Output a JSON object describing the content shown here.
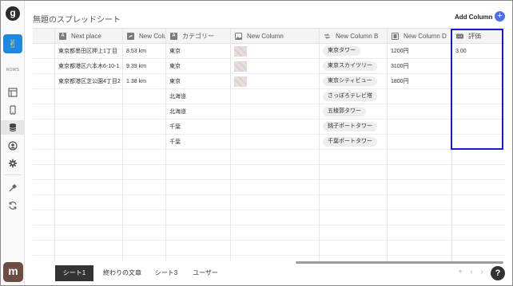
{
  "app": {
    "logo_letter": "g",
    "app_emoji": "✌",
    "rows_label": "ROWS",
    "avatar_letter": "m"
  },
  "header": {
    "title": "無題のスプレッドシート",
    "add_column_label": "Add Column",
    "add_symbol": "+"
  },
  "columns": [
    {
      "label": "Next place",
      "icon": "text-type-icon"
    },
    {
      "label": "New Column",
      "icon": "link-icon"
    },
    {
      "label": "カテゴリー",
      "icon": "text-type-icon"
    },
    {
      "label": "New Column",
      "icon": "image-icon"
    },
    {
      "label": "New Column B",
      "icon": "relation-icon"
    },
    {
      "label": "New Column D",
      "icon": "number-icon"
    },
    {
      "label": "評価",
      "icon": "rating-icon"
    }
  ],
  "rows": [
    {
      "address": "東京都墨田区押上1丁目",
      "distance": "8.53 km",
      "category": "東京",
      "place": "東京タワー",
      "price": "1200円",
      "rating": "3.00"
    },
    {
      "address": "東京都港区六本木6-10-1",
      "distance": "9.39 km",
      "category": "東京",
      "place": "東京スカイツリー",
      "price": "3100円",
      "rating": ""
    },
    {
      "address": "東京都港区芝公園4丁目2",
      "distance": "1.38 km",
      "category": "東京",
      "place": "東京シティビュー",
      "price": "1800円",
      "rating": ""
    },
    {
      "address": "",
      "distance": "",
      "category": "北海道",
      "place": "さっぽろテレビ塔",
      "price": "",
      "rating": ""
    },
    {
      "address": "",
      "distance": "",
      "category": "北海道",
      "place": "五稜郭タワー",
      "price": "",
      "rating": ""
    },
    {
      "address": "",
      "distance": "",
      "category": "千葉",
      "place": "銚子ポートタワー",
      "price": "",
      "rating": ""
    },
    {
      "address": "",
      "distance": "",
      "category": "千葉",
      "place": "千葉ポートタワー",
      "price": "",
      "rating": ""
    }
  ],
  "tabs": [
    "シート1",
    "終わりの文章",
    "シート3",
    "ユーザー"
  ],
  "active_tab": 0,
  "footer": {
    "help_symbol": "?",
    "add_sheet_symbol": "+",
    "prev_symbol": "‹",
    "next_symbol": "›"
  },
  "colors": {
    "accent": "#4e6ef2",
    "highlight_border": "#1a1ad0",
    "app_tile": "#1e88e5",
    "active_tab": "#333333"
  }
}
